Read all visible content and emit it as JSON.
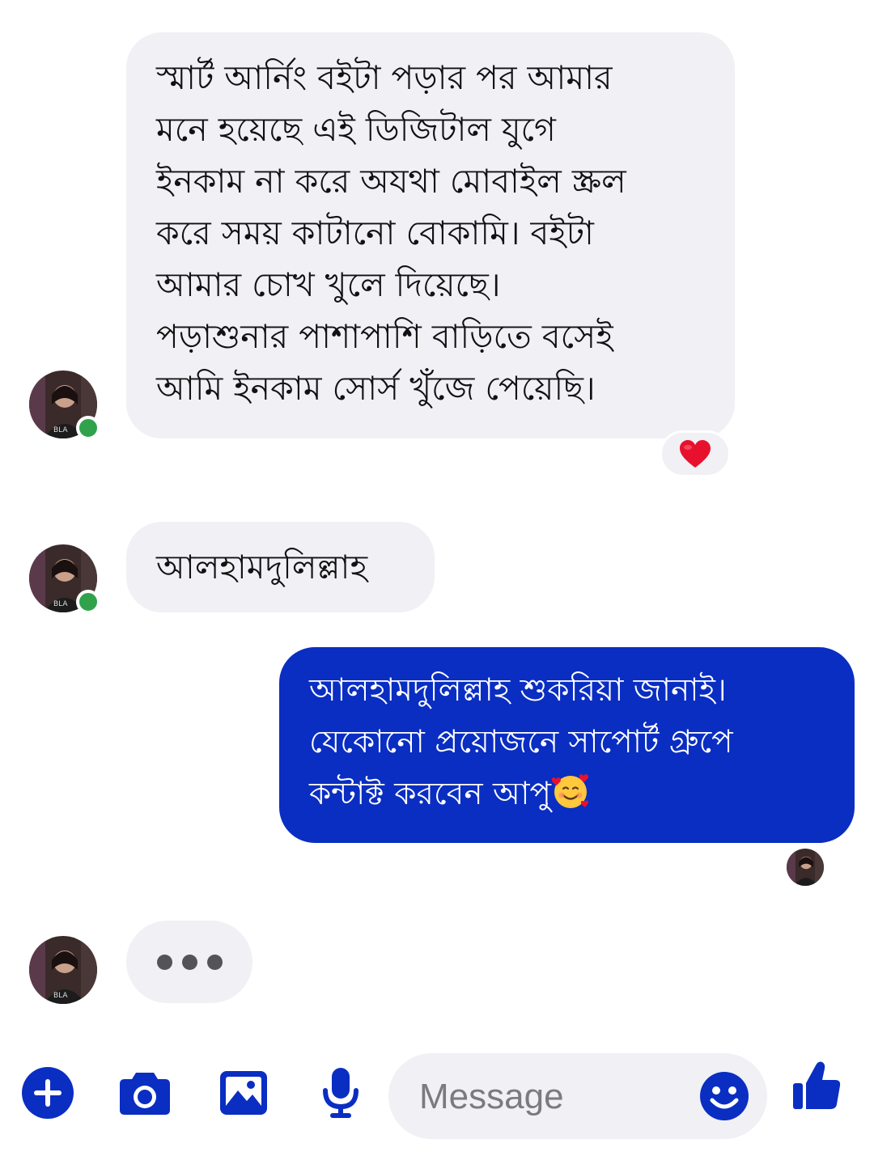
{
  "conversation": {
    "messages": [
      {
        "from": "contact",
        "text": "স্মার্ট আর্নিং বইটা পড়ার পর আমার\nমনে হয়েছে এই ডিজিটাল যুগে\nইনকাম না করে অযথা মোবাইল স্ক্রল\nকরে সময় কাটানো বোকামি। বইটা\nআমার চোখ খুলে দিয়েছে।\nপড়াশুনার পাশাপাশি বাড়িতে বসেই\nআমি ইনকাম সোর্স খুঁজে পেয়েছি।",
        "reaction": "heart-icon"
      },
      {
        "from": "contact",
        "text": "আলহামদুলিল্লাহ"
      },
      {
        "from": "me",
        "text": "আলহামদুলিল্লাহ শুকরিয়া জানাই।\nযেকোনো প্রয়োজনে সাপোর্ট গ্রুপে\nকন্টাক্ট করবেন আপু",
        "trailing_emoji": "smiling-face-with-hearts-icon"
      }
    ],
    "typing_indicator": "contact-typing"
  },
  "composer": {
    "placeholder": "Message",
    "icons": [
      "plus-icon",
      "camera-icon",
      "image-icon",
      "microphone-icon",
      "emoji-icon",
      "thumbs-up-icon"
    ]
  },
  "colors": {
    "outgoing_bubble": "#0a2ec2",
    "incoming_bubble": "#f0f0f5",
    "accent": "#0a2ec2",
    "online": "#31a24c",
    "heart": "#e8112d"
  }
}
